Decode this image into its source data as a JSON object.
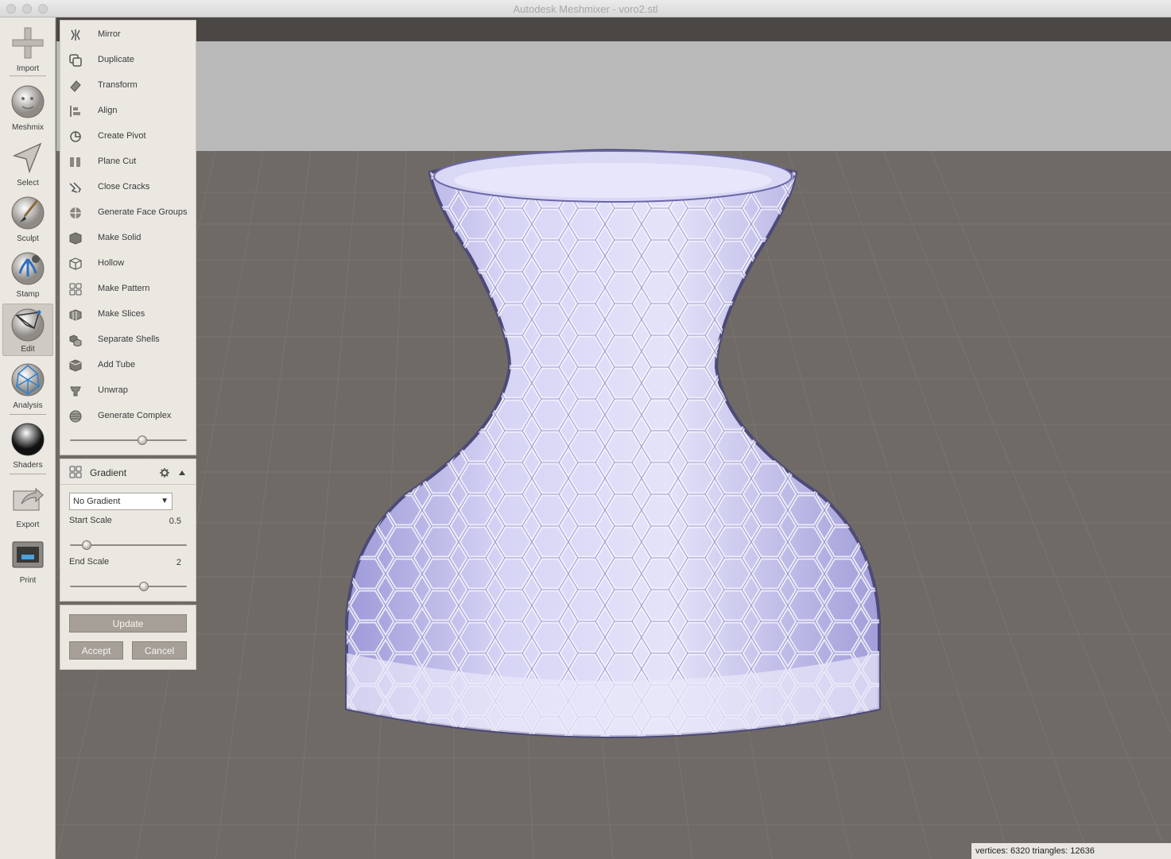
{
  "window": {
    "title": "Autodesk Meshmixer - voro2.stl"
  },
  "toolbar": {
    "items": [
      {
        "label": "Import",
        "icon": "plus-icon"
      },
      {
        "label": "Meshmix",
        "icon": "face-sphere-icon"
      },
      {
        "label": "Select",
        "icon": "arrow-pointer-icon"
      },
      {
        "label": "Sculpt",
        "icon": "brush-sphere-icon"
      },
      {
        "label": "Stamp",
        "icon": "fleur-sphere-icon"
      },
      {
        "label": "Edit",
        "icon": "wire-sphere-icon",
        "active": true
      },
      {
        "label": "Analysis",
        "icon": "geodesic-sphere-icon"
      },
      {
        "label": "Shaders",
        "icon": "chrome-sphere-icon"
      },
      {
        "label": "Export",
        "icon": "export-arrow-icon"
      },
      {
        "label": "Print",
        "icon": "printer-icon"
      }
    ]
  },
  "edit_menu": {
    "items": [
      {
        "label": "Mirror",
        "icon": "mirror-icon"
      },
      {
        "label": "Duplicate",
        "icon": "duplicate-icon"
      },
      {
        "label": "Transform",
        "icon": "transform-icon"
      },
      {
        "label": "Align",
        "icon": "align-icon"
      },
      {
        "label": "Create Pivot",
        "icon": "pivot-icon"
      },
      {
        "label": "Plane Cut",
        "icon": "plane-cut-icon"
      },
      {
        "label": "Close Cracks",
        "icon": "close-cracks-icon"
      },
      {
        "label": "Generate Face Groups",
        "icon": "face-groups-icon"
      },
      {
        "label": "Make Solid",
        "icon": "solid-cube-icon"
      },
      {
        "label": "Hollow",
        "icon": "hollow-cube-icon"
      },
      {
        "label": "Make Pattern",
        "icon": "pattern-grid-icon"
      },
      {
        "label": "Make Slices",
        "icon": "slices-icon"
      },
      {
        "label": "Separate Shells",
        "icon": "shells-icon"
      },
      {
        "label": "Add Tube",
        "icon": "tube-icon"
      },
      {
        "label": "Unwrap",
        "icon": "unwrap-icon"
      },
      {
        "label": "Generate Complex",
        "icon": "complex-icon"
      }
    ],
    "slider_value": 0.62
  },
  "gradient_panel": {
    "title": "Gradient",
    "select_value": "No Gradient",
    "start_scale_label": "Start Scale",
    "start_scale_value": "0.5",
    "start_scale_fraction": 0.14,
    "end_scale_label": "End Scale",
    "end_scale_value": "2",
    "end_scale_fraction": 0.63
  },
  "actions": {
    "update": "Update",
    "accept": "Accept",
    "cancel": "Cancel"
  },
  "status": {
    "text": "vertices: 6320 triangles: 12636"
  },
  "colors": {
    "panel": "#ebe8e2",
    "button": "#a59f98",
    "viewport": "#6f6a66",
    "mesh": "#c8c6ee"
  }
}
